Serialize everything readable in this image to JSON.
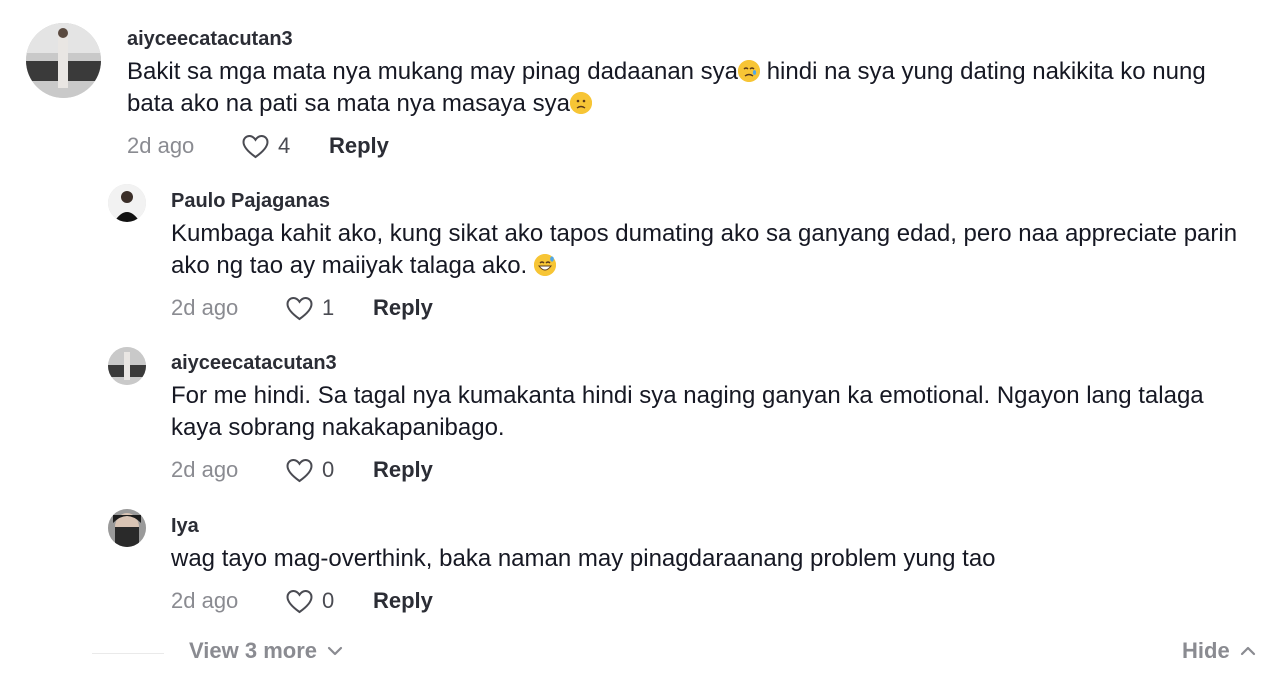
{
  "comments": [
    {
      "username": "aiyceecatacutan3",
      "text_part1": "Bakit sa mga mata nya mukang may pinag dadaanan sya",
      "emoji1": "crying-face-emoji",
      "text_part2": " hindi na sya yung dating nakikita ko nung bata ako na pati sa mata nya masaya sya",
      "emoji2": "slightly-frowning-face-emoji",
      "time": "2d ago",
      "likes": "4",
      "reply_label": "Reply"
    }
  ],
  "replies": [
    {
      "username": "Paulo Pajaganas",
      "text": "Kumbaga kahit ako, kung sikat ako tapos dumating ako sa ganyang edad, pero naa appreciate parin ako ng tao ay maiiyak talaga ako. ",
      "emoji": "grinning-face-with-sweat-emoji",
      "time": "2d ago",
      "likes": "1",
      "reply_label": "Reply"
    },
    {
      "username": "aiyceecatacutan3",
      "text": "For me hindi. Sa tagal nya kumakanta hindi sya naging ganyan ka emotional. Ngayon lang talaga kaya sobrang nakakapanibago.",
      "time": "2d ago",
      "likes": "0",
      "reply_label": "Reply"
    },
    {
      "username": "Iya",
      "text": "wag tayo mag-overthink, baka naman may pinagdaraanang problem yung tao",
      "time": "2d ago",
      "likes": "0",
      "reply_label": "Reply"
    }
  ],
  "footer": {
    "view_more": "View 3 more",
    "hide": "Hide"
  },
  "icons": {
    "like": "heart-outline-icon",
    "view_more": "chevron-down-icon",
    "hide": "chevron-up-icon"
  }
}
